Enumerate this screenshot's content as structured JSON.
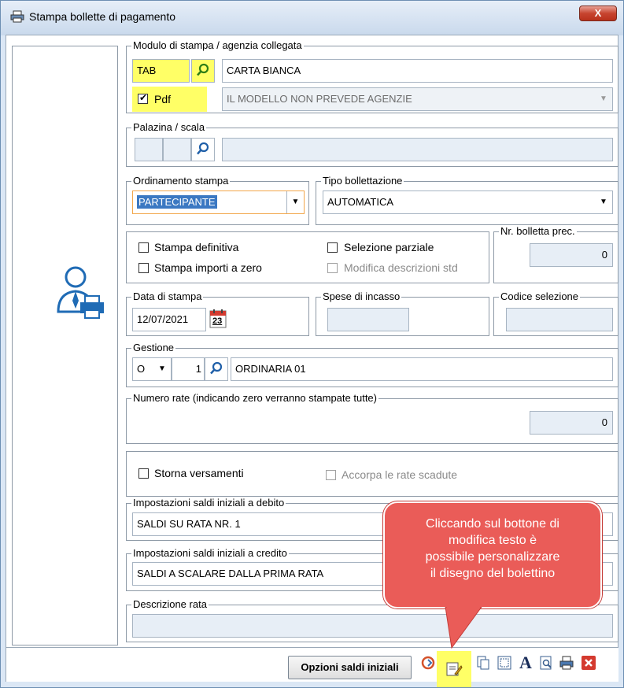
{
  "window": {
    "title": "Stampa bollette di pagamento",
    "close_label": "X"
  },
  "modulo": {
    "legend": "Modulo di stampa / agenzia collegata",
    "code": "TAB",
    "description": "CARTA BIANCA",
    "pdf_label": "Pdf",
    "pdf_checked": true,
    "agency": "IL MODELLO NON PREVEDE AGENZIE"
  },
  "palazzina": {
    "legend": "Palazina / scala",
    "value1": "",
    "value2": "",
    "description": ""
  },
  "ordinamento": {
    "legend": "Ordinamento stampa",
    "value": "PARTECIPANTE"
  },
  "tipo": {
    "legend": "Tipo bollettazione",
    "value": "AUTOMATICA"
  },
  "options": {
    "stampa_definitiva": "Stampa definitiva",
    "selezione_parziale": "Selezione parziale",
    "stampa_importi_zero": "Stampa importi a zero",
    "modifica_descrizioni": "Modifica descrizioni std"
  },
  "nr_bolletta": {
    "legend": "Nr. bolletta prec.",
    "value": "0"
  },
  "data_stampa": {
    "legend": "Data di stampa",
    "value": "12/07/2021",
    "cal_day": "23"
  },
  "spese": {
    "legend": "Spese di incasso",
    "value": ""
  },
  "codice": {
    "legend": "Codice selezione",
    "value": ""
  },
  "gestione": {
    "legend": "Gestione",
    "type": "O",
    "number": "1",
    "description": "ORDINARIA 01"
  },
  "numero_rate": {
    "legend": "Numero rate (indicando zero verranno stampate tutte)",
    "value": "0"
  },
  "storna": {
    "label": "Storna versamenti",
    "accorpa": "Accorpa le rate scadute"
  },
  "saldi_debito": {
    "legend": "Impostazioni saldi iniziali a debito",
    "value": "SALDI SU RATA NR. 1"
  },
  "saldi_credito": {
    "legend": "Impostazioni saldi iniziali a credito",
    "value": "SALDI A SCALARE DALLA PRIMA RATA"
  },
  "descrizione_rata": {
    "legend": "Descrizione rata",
    "value": ""
  },
  "bottom": {
    "opzioni_label": "Opzioni saldi iniziali",
    "font_glyph": "A"
  },
  "callout": {
    "lines": [
      "Cliccando sul bottone di",
      "modifica testo è",
      "possibile personalizzare",
      "il disegno del bolettino"
    ]
  },
  "colors": {
    "highlight": "#ffff66",
    "callout": "#ea5c58",
    "accent": "#3b78c2"
  }
}
